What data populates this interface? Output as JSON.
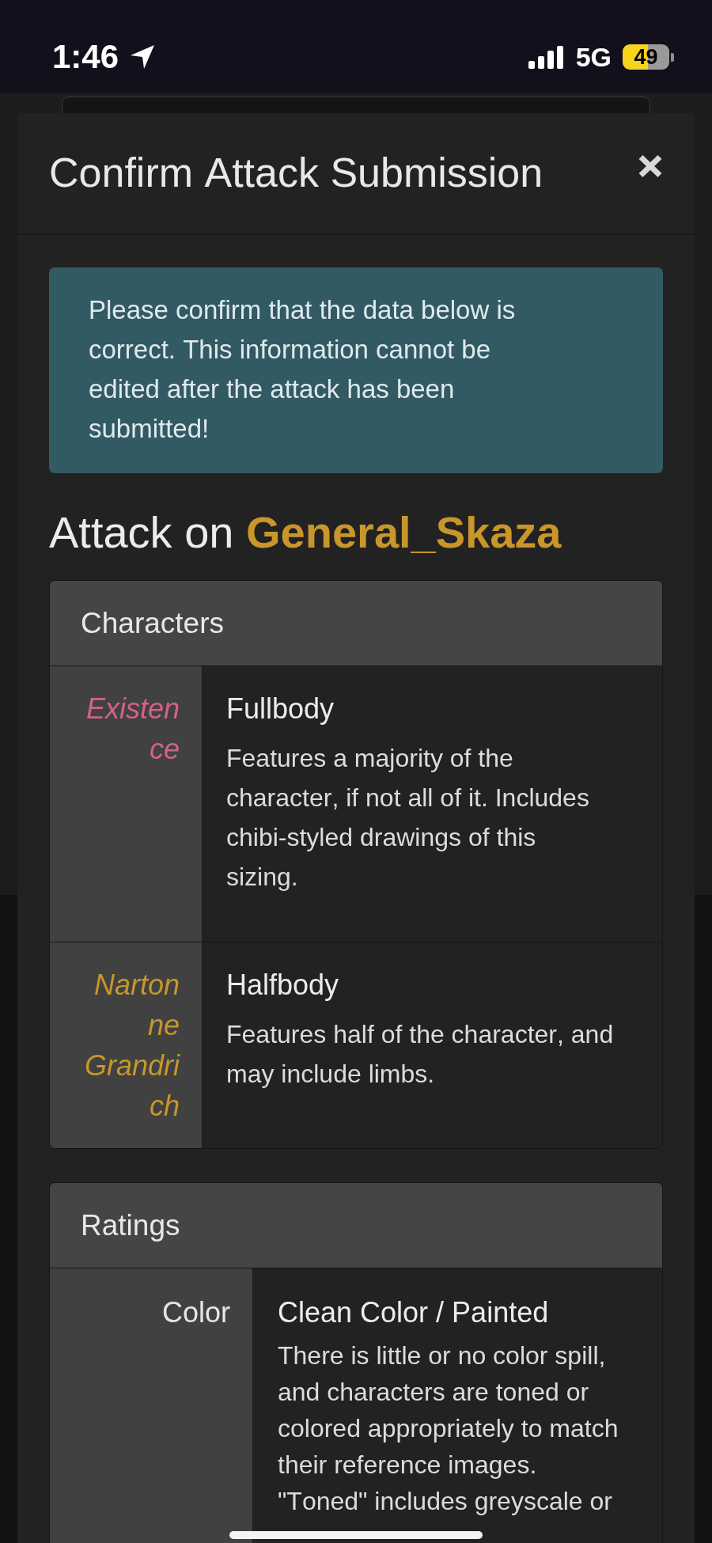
{
  "status_bar": {
    "time": "1:46",
    "network": "5G",
    "battery": "49"
  },
  "modal": {
    "title": "Confirm Attack Submission"
  },
  "alert": {
    "text": "Please confirm that the data below is correct. This information cannot be edited after the attack has been submitted!"
  },
  "heading": "Attack on **General_Skaza**",
  "characters": {
    "title": "Characters",
    "rows": [
      {
        "name": "Existence",
        "color": "#d4618c",
        "size": "Fullbody",
        "description": "Features a majority of the character, if not all of it. Includes chibi-styled drawings of this sizing."
      },
      {
        "name": "Nartonne Grandrich",
        "color": "#c8962b",
        "size": "Halfbody",
        "description": "Features half of the character, and may include limbs."
      }
    ]
  },
  "ratings": {
    "title": "Ratings",
    "rows": [
      {
        "label": "Color",
        "value": "Clean Color / Painted",
        "description": "There is little or no color spill, and characters are toned or colored appropriately to match their reference images. \"Toned\" includes greyscale or"
      }
    ]
  }
}
